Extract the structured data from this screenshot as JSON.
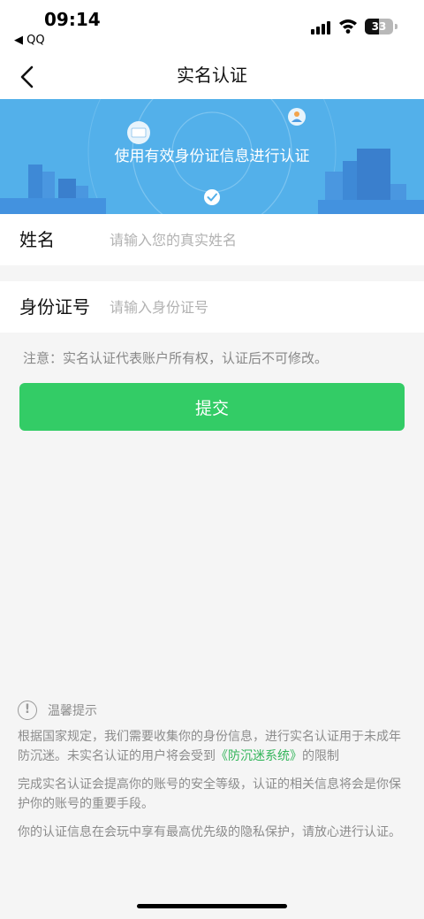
{
  "status_bar": {
    "time": "09:14",
    "back_app": "◀ QQ",
    "battery": "33"
  },
  "nav": {
    "title": "实名认证"
  },
  "banner": {
    "text": "使用有效身份证信息进行认证"
  },
  "form": {
    "name_label": "姓名",
    "name_placeholder": "请输入您的真实姓名",
    "id_label": "身份证号",
    "id_placeholder": "请输入身份证号"
  },
  "note": "注意：实名认证代表账户所有权，认证后不可修改。",
  "submit_label": "提交",
  "tips": {
    "title": "温馨提示",
    "p1_before": "根据国家规定，我们需要收集你的身份信息，进行实名认证用于未成年防沉迷。未实名认证的用户将会受到",
    "p1_highlight": "《防沉迷系统》",
    "p1_after": "的限制",
    "p2": "完成实名认证会提高你的账号的安全等级，认证的相关信息将会是你保护你的账号的重要手段。",
    "p3": "你的认证信息在会玩中享有最高优先级的隐私保护，请放心进行认证。"
  },
  "colors": {
    "banner_bg": "#53b0ea",
    "button_green": "#33cc66",
    "link_green": "#33b55a"
  }
}
